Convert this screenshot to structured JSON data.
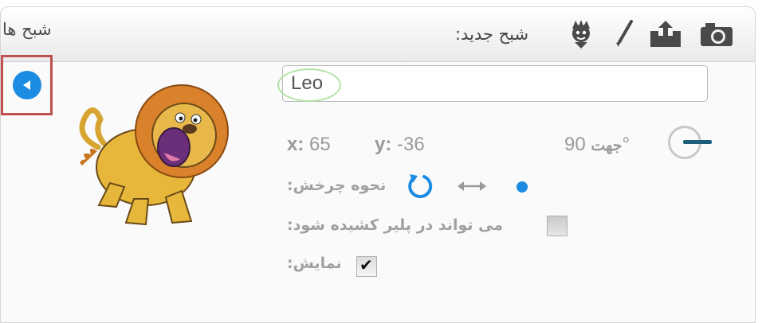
{
  "header": {
    "title": "شبح ها",
    "new_sprite_label": ":شبح جدید"
  },
  "sprite": {
    "name": "Leo",
    "x_label": "x:",
    "x_value": "65",
    "y_label": "y:",
    "y_value": "-36",
    "direction_value": "90°",
    "direction_label": "جهت",
    "rotation_label": ":نحوه چرخش",
    "draggable_label": ":می تواند در پلیر کشیده شود",
    "show_label": ":نمایش",
    "draggable_checked": false,
    "show_checked": true,
    "rotation_style": "all-around"
  },
  "icons": {
    "back": "back-arrow-icon",
    "tools": [
      "choose-sprite-library-icon",
      "paint-brush-icon",
      "upload-sprite-icon",
      "camera-icon"
    ]
  },
  "colors": {
    "accent_blue": "#1c8ce3",
    "highlight_red": "#c0504d",
    "label_gray": "#a0a0a0"
  }
}
